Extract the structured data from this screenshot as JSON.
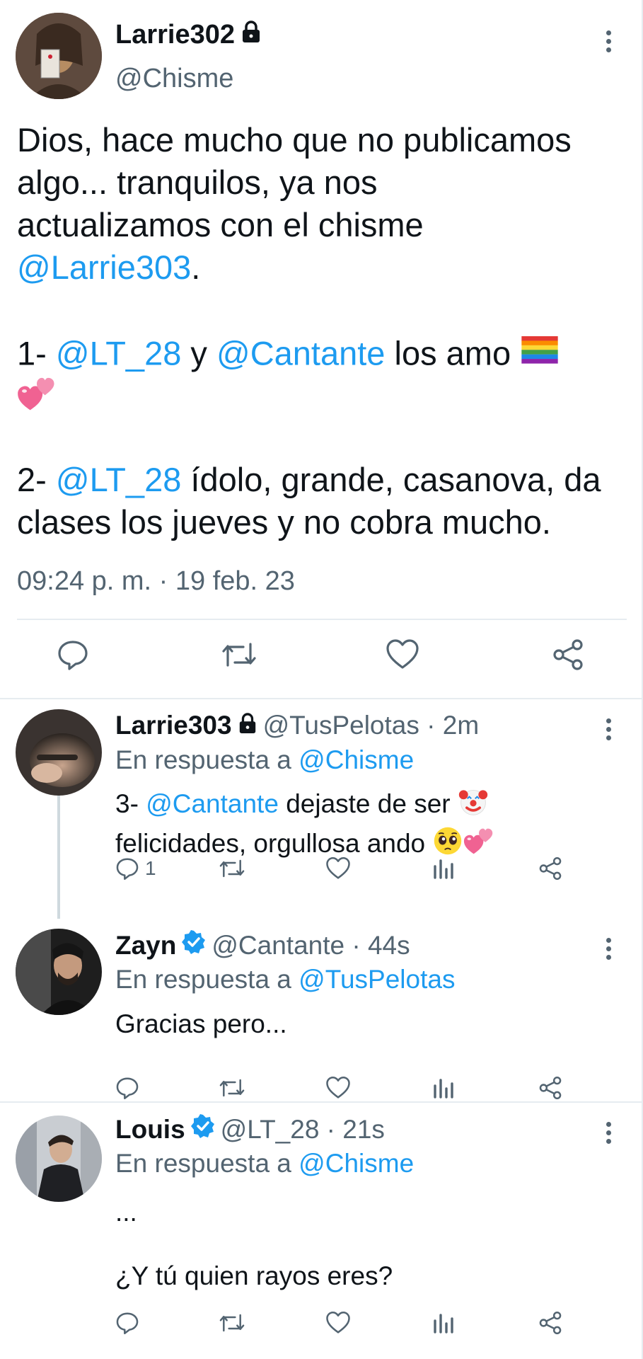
{
  "main_tweet": {
    "author_name": "Larrie302",
    "author_handle": "@Chisme",
    "text_lines": [
      [
        {
          "t": "Dios, hace mucho que no publicamos"
        }
      ],
      [
        {
          "t": "algo... tranquilos, ya nos"
        }
      ],
      [
        {
          "t": "actualizamos con el chisme"
        }
      ],
      [
        {
          "t": "@Larrie303",
          "link": true
        },
        {
          "t": "."
        }
      ],
      [],
      [
        {
          "t": "1- "
        },
        {
          "t": "@LT_28",
          "link": true
        },
        {
          "t": " y "
        },
        {
          "t": "@Cantante",
          "link": true
        },
        {
          "t": " los amo "
        },
        {
          "e": "rainbow-flag-emoji"
        }
      ],
      [
        {
          "e": "two-hearts-emoji"
        }
      ],
      [],
      [
        {
          "t": "2- "
        },
        {
          "t": "@LT_28",
          "link": true
        },
        {
          "t": " ídolo, grande, casanova, da"
        }
      ],
      [
        {
          "t": "clases los jueves y no cobra mucho."
        }
      ]
    ],
    "timestamp": "09:24 p. m. · 19 feb. 23"
  },
  "replies": [
    {
      "author_name": "Larrie303",
      "protected": true,
      "verified": false,
      "handle_time": "@TusPelotas · 2m",
      "in_reply_prefix": "En respuesta a ",
      "in_reply_to": "@Chisme",
      "body_lines": [
        [
          {
            "t": "3- "
          },
          {
            "t": "@Cantante",
            "link": true
          },
          {
            "t": " dejaste de ser "
          },
          {
            "e": "clown-emoji"
          }
        ],
        [
          {
            "t": "felicidades, orgullosa ando "
          },
          {
            "e": "pleading-face-emoji"
          },
          {
            "e": "two-hearts-emoji"
          }
        ]
      ],
      "reply_count": "1"
    },
    {
      "author_name": "Zayn",
      "protected": false,
      "verified": true,
      "handle_time": "@Cantante · 44s",
      "in_reply_prefix": "En respuesta a ",
      "in_reply_to": "@TusPelotas",
      "body_lines": [
        [
          {
            "t": "Gracias pero..."
          }
        ]
      ],
      "reply_count": ""
    },
    {
      "author_name": "Louis",
      "protected": false,
      "verified": true,
      "handle_time": "@LT_28 · 21s",
      "in_reply_prefix": "En respuesta a ",
      "in_reply_to": "@Chisme",
      "body_lines": [
        [
          {
            "t": "..."
          }
        ],
        [],
        [
          {
            "t": "¿Y tú quien rayos eres?"
          }
        ]
      ],
      "reply_count": ""
    }
  ],
  "icons": {
    "reply": "speech-bubble-icon",
    "retweet": "retweet-icon",
    "like": "heart-icon",
    "views": "bar-chart-icon",
    "share": "share-icon",
    "more": "more-vertical-icon",
    "protected": "lock-icon",
    "verified": "verified-badge-icon"
  },
  "colors": {
    "link": "#1d9bf0",
    "muted": "#536471",
    "text": "#0f1419",
    "divider": "#e6ecf0",
    "verified": "#1d9bf0"
  }
}
